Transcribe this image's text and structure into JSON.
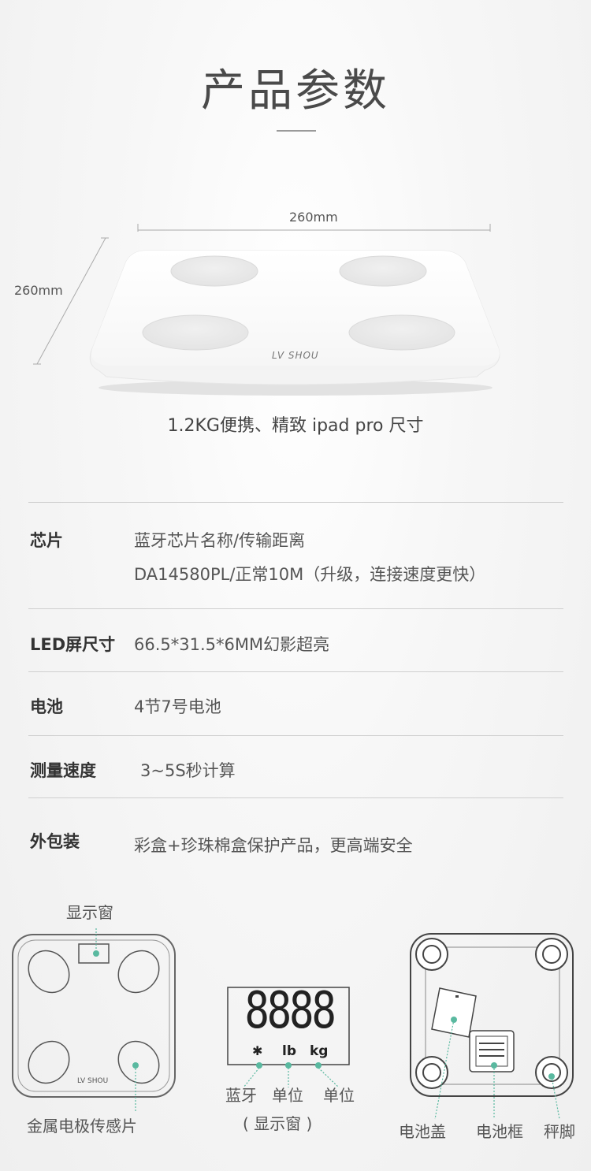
{
  "page_title": "产品参数",
  "dimensions": {
    "width_label": "260mm",
    "depth_label": "260mm"
  },
  "brand": "LV SHOU",
  "caption": "1.2KG便携、精致 ipad pro 尺寸",
  "specs": [
    {
      "label": "芯片",
      "value_line1": "蓝牙芯片名称/传输距离",
      "value_line2": "DA14580PL/正常10M（升级，连接速度更快）"
    },
    {
      "label": "LED屏尺寸",
      "value_line1": "66.5*31.5*6MM幻影超亮"
    },
    {
      "label": "电池",
      "value_line1": "4节7号电池"
    },
    {
      "label": "测量速度",
      "value_line1": "3~5S秒计算"
    },
    {
      "label": "外包装",
      "value_line1": "彩盒+珍珠棉盒保护产品，更高端安全"
    }
  ],
  "diagram": {
    "display_window": "显示窗",
    "electrode": "金属电极传感片",
    "lcd_digits": "8888",
    "lcd_lb": "lb",
    "lcd_kg": "kg",
    "bluetooth": "蓝牙",
    "unit_1": "单位",
    "unit_2": "单位",
    "display_window_paren": "( 显示窗 )",
    "battery_cover": "电池盖",
    "battery_frame": "电池框",
    "scale_foot": "秤脚"
  },
  "colors": {
    "accent": "#5ab9a0",
    "text": "#444444",
    "rule": "#cfcfcf"
  }
}
